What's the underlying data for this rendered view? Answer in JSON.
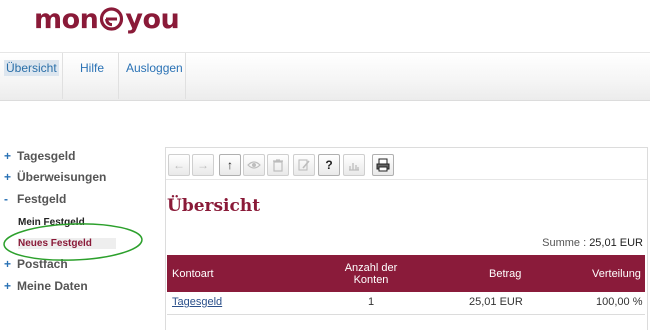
{
  "brand": {
    "logo_left": "mon",
    "logo_right": "you"
  },
  "topnav": {
    "tabs": [
      {
        "label": "Übersicht",
        "active": true
      },
      {
        "label": "Hilfe",
        "active": false
      },
      {
        "label": "Ausloggen",
        "active": false
      }
    ]
  },
  "sidebar": {
    "items": [
      {
        "sign": "+",
        "label": "Tagesgeld"
      },
      {
        "sign": "+",
        "label": "Überweisungen"
      },
      {
        "sign": "-",
        "label": "Festgeld"
      },
      {
        "sign": "+",
        "label": "Postfach"
      },
      {
        "sign": "+",
        "label": "Meine Daten"
      }
    ],
    "subitems": [
      {
        "label": "Mein Festgeld",
        "active": false
      },
      {
        "label": "Neues Festgeld",
        "active": true
      }
    ]
  },
  "toolbar": {
    "buttons": [
      {
        "icon": "arrow-left-icon",
        "glyph": "←",
        "enabled": false
      },
      {
        "icon": "arrow-right-icon",
        "glyph": "→",
        "enabled": false
      },
      {
        "icon": "arrow-up-icon",
        "glyph": "↑",
        "enabled": true
      },
      {
        "icon": "eye-icon",
        "glyph": "",
        "enabled": false
      },
      {
        "icon": "trash-icon",
        "glyph": "",
        "enabled": false
      },
      {
        "icon": "edit-icon",
        "glyph": "",
        "enabled": false
      },
      {
        "icon": "help-icon",
        "glyph": "?",
        "enabled": true
      },
      {
        "icon": "chart-icon",
        "glyph": "",
        "enabled": false
      },
      {
        "icon": "print-icon",
        "glyph": "",
        "enabled": true
      }
    ]
  },
  "main": {
    "title": "Übersicht",
    "summe_label": "Summe :",
    "summe_value": "25,01 EUR"
  },
  "table": {
    "headers": {
      "kontoart": "Kontoart",
      "anzahl_line1": "Anzahl der",
      "anzahl_line2": "Konten",
      "betrag": "Betrag",
      "verteilung": "Verteilung"
    },
    "rows": [
      {
        "kontoart": "Tagesgeld",
        "anzahl": "1",
        "betrag": "25,01 EUR",
        "verteilung": "100,00 %"
      }
    ]
  },
  "colors": {
    "brand": "#8a1a38",
    "header_bg": "#8a1b3a",
    "link": "#2a72b5",
    "annotation": "#2ca02c"
  }
}
